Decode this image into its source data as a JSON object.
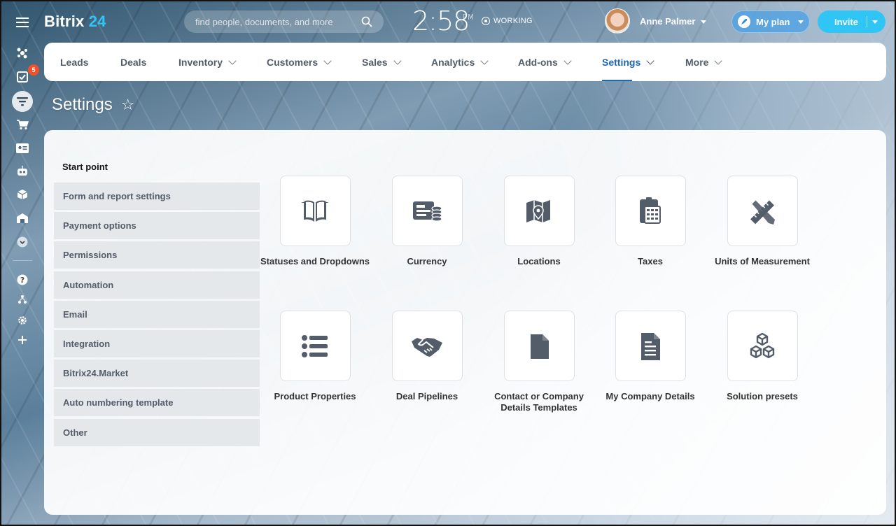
{
  "app": {
    "logo_text": "Bitrix",
    "logo_num": "24"
  },
  "header": {
    "search_placeholder": "find people, documents, and more",
    "clock": "2:58",
    "ampm": "PM",
    "status": "WORKING",
    "user_name": "Anne Palmer",
    "my_plan": "My plan",
    "invite": "Invite"
  },
  "rail": {
    "tasks_badge": "5"
  },
  "nav": [
    {
      "label": "Leads"
    },
    {
      "label": "Deals"
    },
    {
      "label": "Inventory"
    },
    {
      "label": "Customers"
    },
    {
      "label": "Sales"
    },
    {
      "label": "Analytics"
    },
    {
      "label": "Add-ons"
    },
    {
      "label": "Settings"
    },
    {
      "label": "More"
    }
  ],
  "page": {
    "title": "Settings"
  },
  "sidebar": {
    "title": "Start point",
    "items": [
      "Form and report settings",
      "Payment options",
      "Permissions",
      "Automation",
      "Email",
      "Integration",
      "Bitrix24.Market",
      "Auto numbering template",
      "Other"
    ]
  },
  "tiles": [
    {
      "label": "Statuses and Dropdowns",
      "icon": "book-icon"
    },
    {
      "label": "Currency",
      "icon": "currency-icon"
    },
    {
      "label": "Locations",
      "icon": "map-pin-icon"
    },
    {
      "label": "Taxes",
      "icon": "calculator-icon"
    },
    {
      "label": "Units of Measurement",
      "icon": "ruler-pencil-icon"
    },
    {
      "label": "Product Properties",
      "icon": "list-icon"
    },
    {
      "label": "Deal Pipelines",
      "icon": "handshake-icon"
    },
    {
      "label": "Contact or Company Details Templates",
      "icon": "document-icon"
    },
    {
      "label": "My Company Details",
      "icon": "document-lines-icon"
    },
    {
      "label": "Solution presets",
      "icon": "cubes-icon"
    }
  ],
  "colors": {
    "accent": "#2fc6f6",
    "active_nav": "#2067b0",
    "badge": "#f0512b"
  }
}
